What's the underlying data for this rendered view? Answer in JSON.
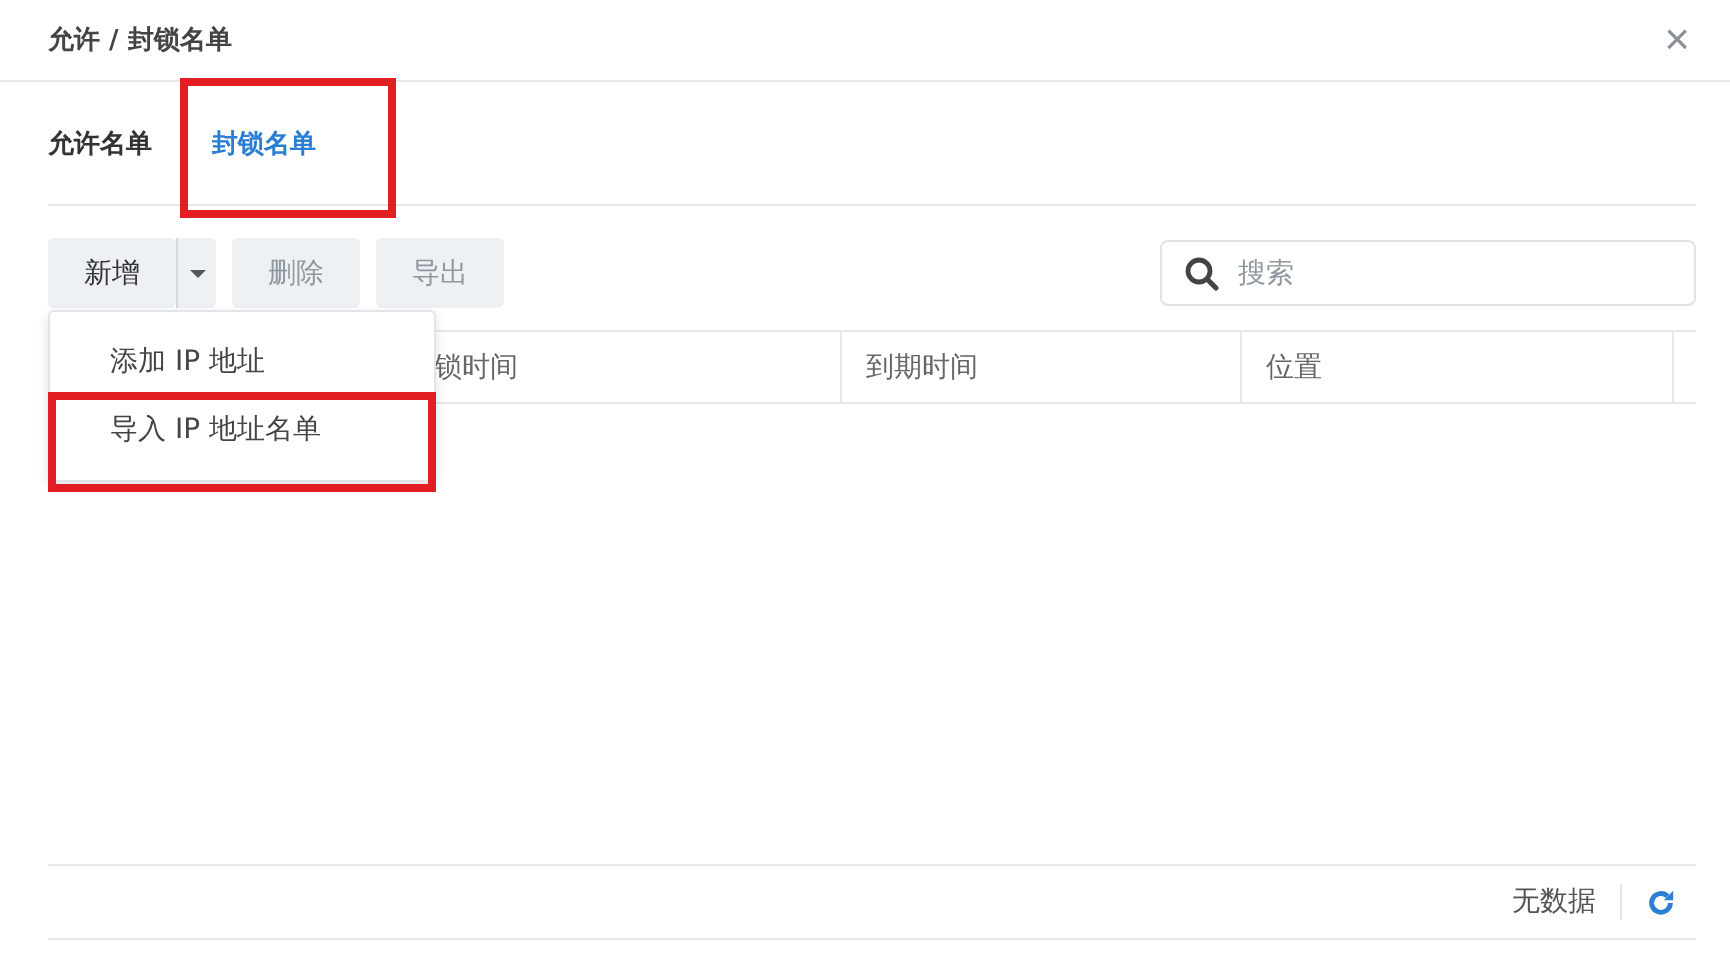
{
  "window": {
    "title": "允许 / 封锁名单",
    "close": "×"
  },
  "tabs": [
    {
      "label": "允许名单",
      "selected": false,
      "highlighted": false
    },
    {
      "label": "封锁名单",
      "selected": true,
      "highlighted": true
    }
  ],
  "toolbar": {
    "buttons": [
      {
        "label": "新增",
        "disabled": false,
        "dropdown": true
      },
      {
        "label": "删除",
        "disabled": true,
        "dropdown": false
      },
      {
        "label": "导出",
        "disabled": true,
        "dropdown": false
      }
    ],
    "search": {
      "placeholder": "搜索"
    }
  },
  "menu": {
    "items": [
      {
        "label": "添加 IP 地址",
        "highlighted": false
      },
      {
        "label": "导入 IP 地址名单",
        "highlighted": true
      }
    ]
  },
  "table": {
    "columns": [
      "锁时间",
      "到期时间",
      "位置"
    ]
  },
  "status_bar": {
    "text": "无数据"
  }
}
